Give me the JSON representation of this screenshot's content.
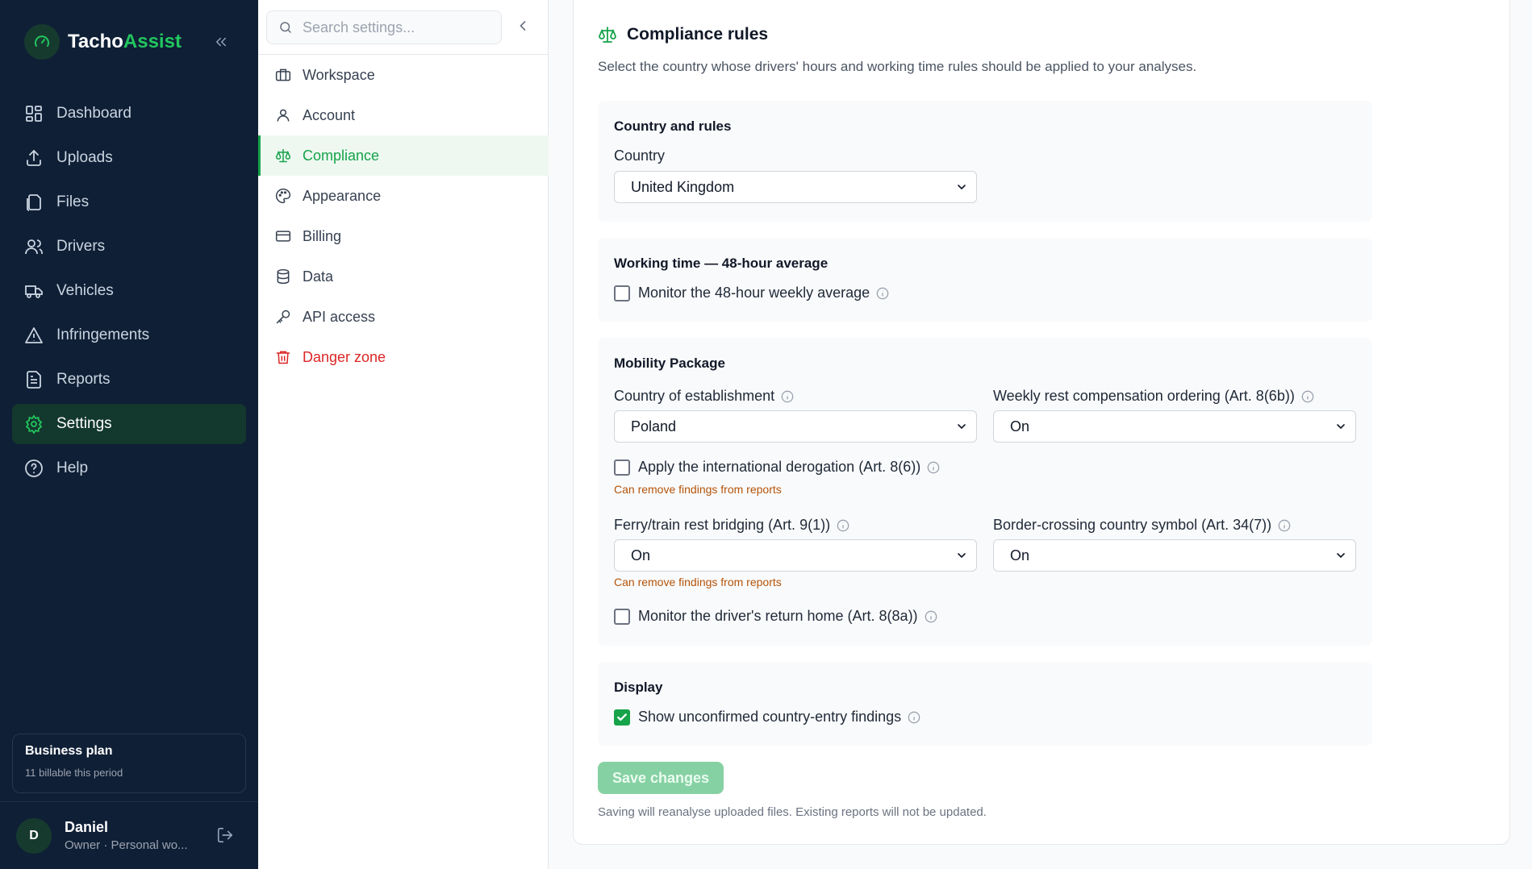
{
  "brand": {
    "part1": "Tacho",
    "part2": "Assist"
  },
  "sidebar": {
    "items": [
      {
        "label": "Dashboard",
        "icon": "dashboard-icon"
      },
      {
        "label": "Uploads",
        "icon": "upload-icon"
      },
      {
        "label": "Files",
        "icon": "files-icon"
      },
      {
        "label": "Drivers",
        "icon": "users-icon"
      },
      {
        "label": "Vehicles",
        "icon": "truck-icon"
      },
      {
        "label": "Infringements",
        "icon": "warning-icon"
      },
      {
        "label": "Reports",
        "icon": "report-icon"
      },
      {
        "label": "Settings",
        "icon": "gear-icon",
        "active": true
      },
      {
        "label": "Help",
        "icon": "help-icon"
      }
    ],
    "plan": {
      "title": "Business plan",
      "subtitle": "11 billable this period"
    },
    "user": {
      "initial": "D",
      "name": "Daniel",
      "role": "Owner · Personal wo..."
    }
  },
  "settings_nav": {
    "search_placeholder": "Search settings...",
    "items": [
      {
        "label": "Workspace",
        "icon": "briefcase-icon"
      },
      {
        "label": "Account",
        "icon": "user-icon"
      },
      {
        "label": "Compliance",
        "icon": "scale-icon",
        "active": true
      },
      {
        "label": "Appearance",
        "icon": "palette-icon"
      },
      {
        "label": "Billing",
        "icon": "credit-card-icon"
      },
      {
        "label": "Data",
        "icon": "database-icon"
      },
      {
        "label": "API access",
        "icon": "key-icon"
      },
      {
        "label": "Danger zone",
        "icon": "trash-icon",
        "danger": true
      }
    ]
  },
  "main": {
    "title": "Compliance rules",
    "description": "Select the country whose drivers' hours and working time rules should be applied to your analyses.",
    "country_section": {
      "title": "Country and rules",
      "country_label": "Country",
      "country_value": "United Kingdom"
    },
    "working_time": {
      "title": "Working time — 48-hour average",
      "monitor_label": "Monitor the 48-hour weekly average",
      "monitor_checked": false
    },
    "mobility": {
      "title": "Mobility Package",
      "establishment_label": "Country of establishment",
      "establishment_value": "Poland",
      "weekly_rest_label": "Weekly rest compensation ordering (Art. 8(6b))",
      "weekly_rest_value": "On",
      "derogation_label": "Apply the international derogation (Art. 8(6))",
      "derogation_checked": false,
      "derogation_warning": "Can remove findings from reports",
      "ferry_label": "Ferry/train rest bridging (Art. 9(1))",
      "ferry_value": "On",
      "ferry_warning": "Can remove findings from reports",
      "border_label": "Border-crossing country symbol (Art. 34(7))",
      "border_value": "On",
      "return_home_label": "Monitor the driver's return home (Art. 8(8a))",
      "return_home_checked": false
    },
    "display": {
      "title": "Display",
      "unconfirmed_label": "Show unconfirmed country-entry findings",
      "unconfirmed_checked": true
    },
    "save_label": "Save changes",
    "save_note": "Saving will reanalyse uploaded files. Existing reports will not be updated."
  },
  "colors": {
    "accent": "#16a34a",
    "sidebar_bg": "#0f1f36",
    "danger": "#dc2626",
    "warning": "#b45309"
  }
}
